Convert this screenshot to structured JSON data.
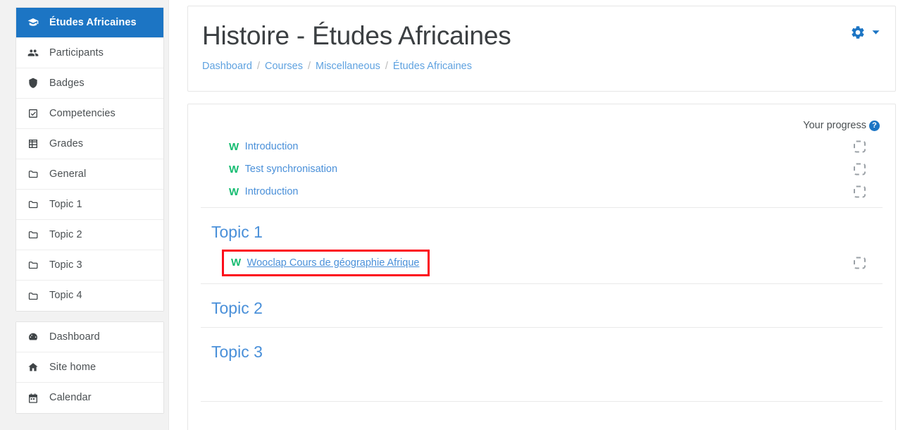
{
  "sidebar": {
    "course_nav": [
      {
        "label": "Études Africaines",
        "icon": "graduation-cap-icon",
        "active": true
      },
      {
        "label": "Participants",
        "icon": "users-icon",
        "active": false
      },
      {
        "label": "Badges",
        "icon": "shield-icon",
        "active": false
      },
      {
        "label": "Competencies",
        "icon": "check-square-icon",
        "active": false
      },
      {
        "label": "Grades",
        "icon": "table-grid-icon",
        "active": false
      },
      {
        "label": "General",
        "icon": "folder-icon",
        "active": false
      },
      {
        "label": "Topic 1",
        "icon": "folder-icon",
        "active": false
      },
      {
        "label": "Topic 2",
        "icon": "folder-icon",
        "active": false
      },
      {
        "label": "Topic 3",
        "icon": "folder-icon",
        "active": false
      },
      {
        "label": "Topic 4",
        "icon": "folder-icon",
        "active": false
      }
    ],
    "site_nav": [
      {
        "label": "Dashboard",
        "icon": "dashboard-icon"
      },
      {
        "label": "Site home",
        "icon": "home-icon"
      },
      {
        "label": "Calendar",
        "icon": "calendar-icon"
      }
    ]
  },
  "header": {
    "title": "Histoire - Études Africaines",
    "breadcrumb": [
      {
        "label": "Dashboard"
      },
      {
        "label": "Courses"
      },
      {
        "label": "Miscellaneous"
      },
      {
        "label": "Études Africaines"
      }
    ],
    "separator": "/",
    "gear_icon": "gear-icon",
    "caret_icon": "chevron-down-icon"
  },
  "content": {
    "progress_label": "Your progress",
    "help_glyph": "?",
    "wooclap_glyph": "W",
    "sections": [
      {
        "title": null,
        "activities": [
          {
            "name": "Introduction",
            "icon": "wooclap-icon",
            "highlighted": false
          },
          {
            "name": "Test synchronisation",
            "icon": "wooclap-icon",
            "highlighted": false
          },
          {
            "name": "Introduction",
            "icon": "wooclap-icon",
            "highlighted": false
          }
        ]
      },
      {
        "title": "Topic 1",
        "activities": [
          {
            "name": "Wooclap Cours de géographie Afrique",
            "icon": "wooclap-icon",
            "highlighted": true
          }
        ]
      },
      {
        "title": "Topic 2",
        "activities": []
      },
      {
        "title": "Topic 3",
        "activities": []
      }
    ]
  },
  "colors": {
    "accent_blue": "#1c75c4",
    "link_blue": "#4a90d9",
    "wooclap_green": "#18bd72",
    "highlight_red": "#fc0d1b",
    "sidebar_bg": "#f2f2f2"
  }
}
